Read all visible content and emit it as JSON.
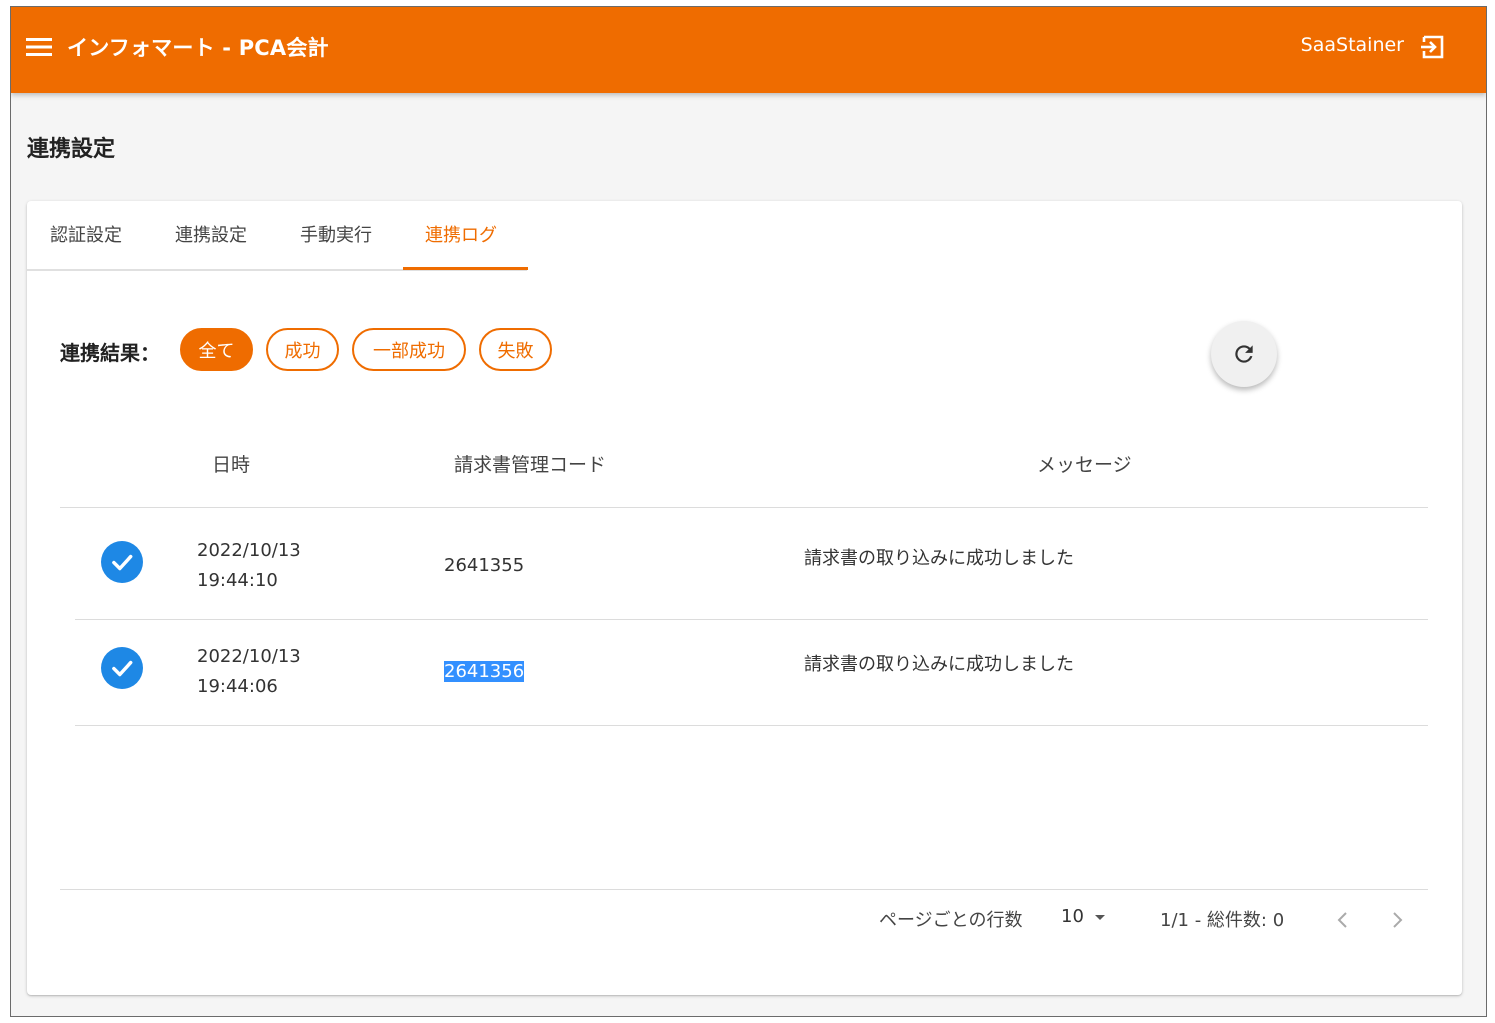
{
  "header": {
    "title": "インフォマート - PCA会計",
    "user": "SaaStainer",
    "bg_color": "#ef6c00",
    "menu_icon": "menu-icon",
    "logout_icon": "logout-icon"
  },
  "page": {
    "title": "連携設定"
  },
  "tabs": [
    {
      "label": "認証設定",
      "active": false
    },
    {
      "label": "連携設定",
      "active": false
    },
    {
      "label": "手動実行",
      "active": false
    },
    {
      "label": "連携ログ",
      "active": true
    }
  ],
  "filter": {
    "label": "連携結果：",
    "chips": [
      {
        "label": "全て",
        "active": true
      },
      {
        "label": "成功",
        "active": false
      },
      {
        "label": "一部成功",
        "active": false
      },
      {
        "label": "失敗",
        "active": false
      }
    ]
  },
  "table": {
    "headers": {
      "date": "日時",
      "code": "請求書管理コード",
      "message": "メッセージ"
    },
    "rows": [
      {
        "date": "2022/10/13",
        "time": "19:44:10",
        "code": "2641355",
        "message": "請求書の取り込みに成功しました",
        "status_icon": "check-circle-icon"
      },
      {
        "date": "2022/10/13",
        "time": "19:44:06",
        "code": "2641356",
        "message": "請求書の取り込みに成功しました",
        "status_icon": "check-circle-icon"
      }
    ]
  },
  "pagination": {
    "rows_per_page_label": "ページごとの行数",
    "rows_per_page": "10",
    "summary": "1/1 - 総件数: 0"
  },
  "colors": {
    "accent": "#ef6c00",
    "success": "#1e88e5",
    "selection": "#3390ff"
  }
}
